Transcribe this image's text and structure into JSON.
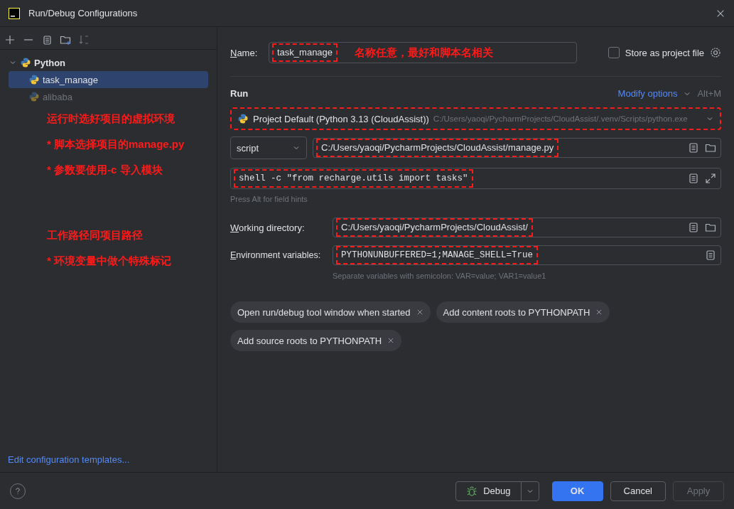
{
  "window": {
    "title": "Run/Debug Configurations"
  },
  "tree": [
    {
      "label": "Python",
      "expanded": true,
      "children": [
        {
          "label": "task_manage",
          "selected": true,
          "disabled": false
        },
        {
          "label": "alibaba",
          "selected": false,
          "disabled": true
        }
      ]
    }
  ],
  "notes": [
    "运行时选好项目的虚拟环境",
    "* 脚本选择项目的manage.py",
    "* 参数要使用-c 导入模块",
    "工作路径同项目路径",
    "* 环境变量中做个特殊标记"
  ],
  "templates_link": "Edit configuration templates...",
  "name": {
    "label": "Name:",
    "value": "task_manage",
    "highlighted": true,
    "note": "名称任意，最好和脚本名相关"
  },
  "store_as_project_file": {
    "label": "Store as project file",
    "checked": false
  },
  "run": {
    "title": "Run",
    "modify_options": "Modify options",
    "shortcut": "Alt+M"
  },
  "interpreter": {
    "name": "Project Default (Python 3.13 (CloudAssist))",
    "path": "C:/Users/yaoqi/PycharmProjects/CloudAssist/.venv/Scripts/python.exe",
    "highlighted": true
  },
  "script": {
    "type": "script",
    "path": "C:/Users/yaoqi/PycharmProjects/CloudAssist/manage.py",
    "highlighted": true
  },
  "parameters": {
    "value": "shell -c \"from recharge.utils import tasks\"",
    "highlighted": true
  },
  "field_hint": "Press Alt for field hints",
  "working_directory": {
    "label": "Working directory:",
    "value": "C:/Users/yaoqi/PycharmProjects/CloudAssist/",
    "highlighted": true
  },
  "environment": {
    "label": "Environment variables:",
    "value": "PYTHONUNBUFFERED=1;MANAGE_SHELL=True",
    "highlighted": true,
    "hint": "Separate variables with semicolon: VAR=value; VAR1=value1"
  },
  "options": [
    "Open run/debug tool window when started",
    "Add content roots to PYTHONPATH",
    "Add source roots to PYTHONPATH"
  ],
  "footer": {
    "debug": "Debug",
    "ok": "OK",
    "cancel": "Cancel",
    "apply": "Apply",
    "apply_disabled": true
  }
}
